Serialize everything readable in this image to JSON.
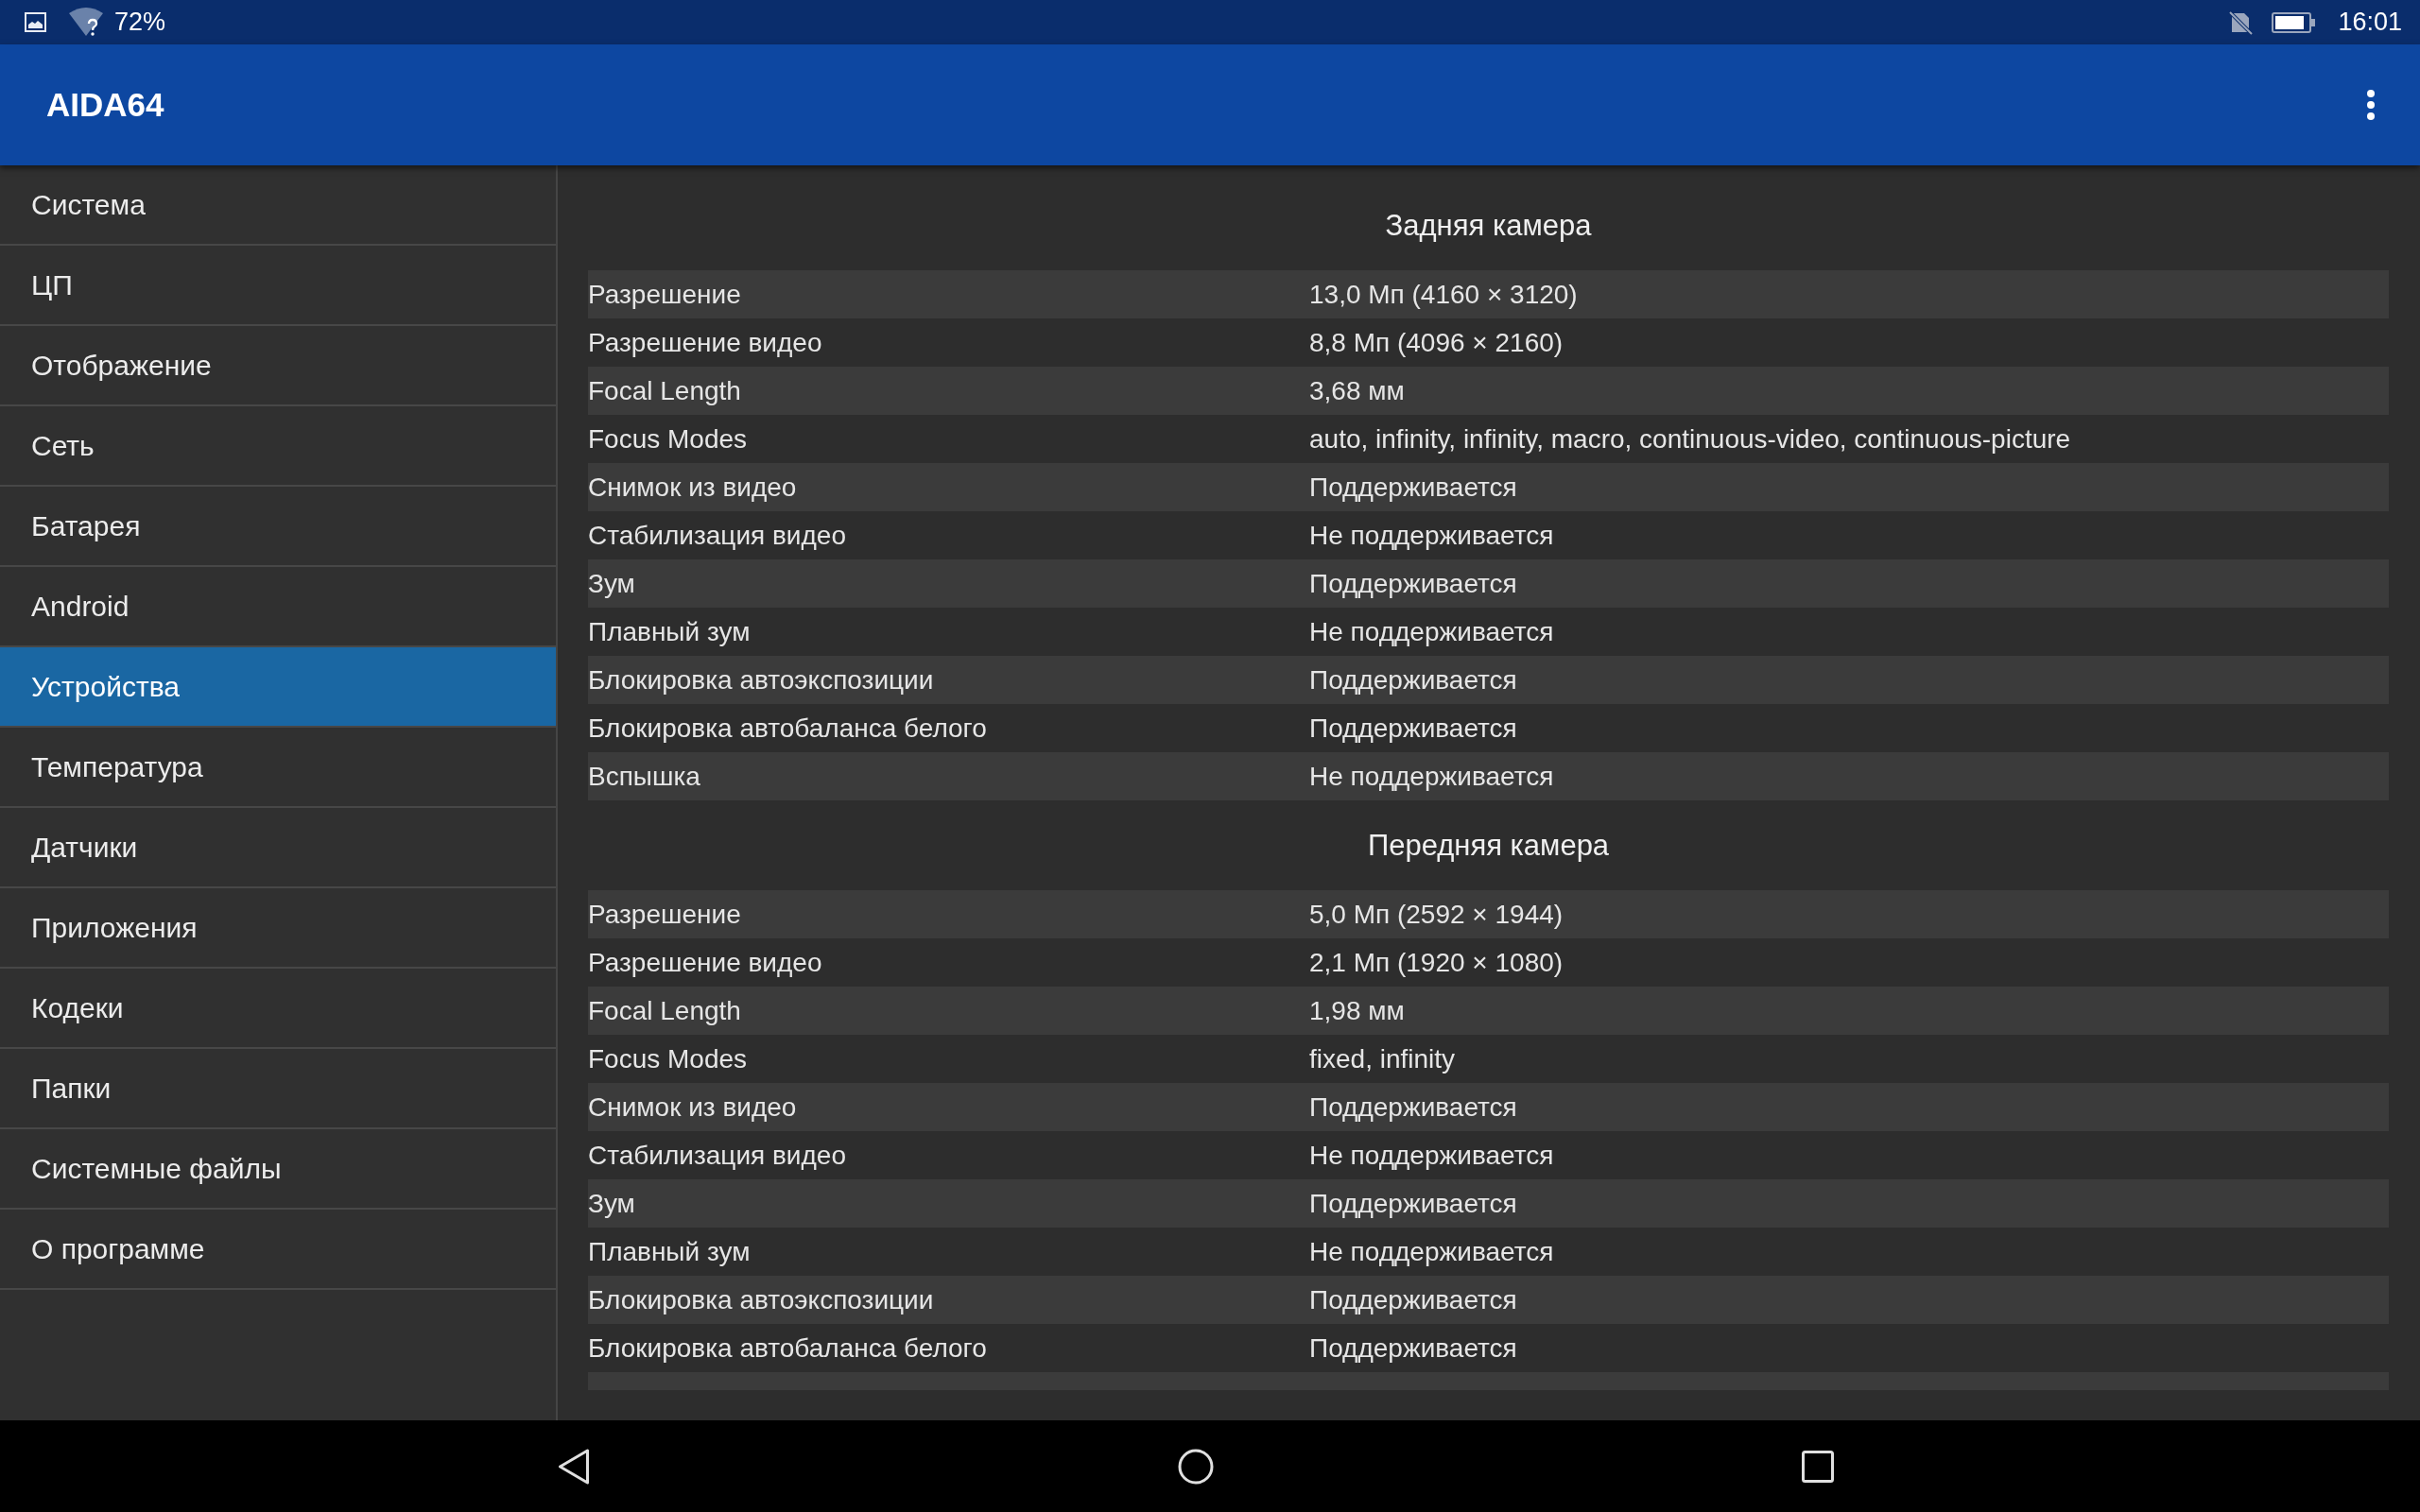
{
  "status_bar": {
    "battery_percent": "72%",
    "time": "16:01"
  },
  "app_bar": {
    "title": "AIDA64"
  },
  "sidebar": {
    "items": [
      {
        "label": "Система",
        "selected": false
      },
      {
        "label": "ЦП",
        "selected": false
      },
      {
        "label": "Отображение",
        "selected": false
      },
      {
        "label": "Сеть",
        "selected": false
      },
      {
        "label": "Батарея",
        "selected": false
      },
      {
        "label": "Android",
        "selected": false
      },
      {
        "label": "Устройства",
        "selected": true
      },
      {
        "label": "Температура",
        "selected": false
      },
      {
        "label": "Датчики",
        "selected": false
      },
      {
        "label": "Приложения",
        "selected": false
      },
      {
        "label": "Кодеки",
        "selected": false
      },
      {
        "label": "Папки",
        "selected": false
      },
      {
        "label": "Системные файлы",
        "selected": false
      },
      {
        "label": "О программе",
        "selected": false
      }
    ]
  },
  "sections": [
    {
      "title": "Задняя камера",
      "rows": [
        {
          "label": "Разрешение",
          "value": "13,0 Мп (4160 × 3120)"
        },
        {
          "label": "Разрешение видео",
          "value": "8,8 Мп (4096 × 2160)"
        },
        {
          "label": "Focal Length",
          "value": "3,68 мм"
        },
        {
          "label": "Focus Modes",
          "value": "auto, infinity, infinity, macro, continuous-video, continuous-picture"
        },
        {
          "label": "Снимок из видео",
          "value": "Поддерживается"
        },
        {
          "label": "Стабилизация видео",
          "value": "Не поддерживается"
        },
        {
          "label": "Зум",
          "value": "Поддерживается"
        },
        {
          "label": "Плавный зум",
          "value": "Не поддерживается"
        },
        {
          "label": "Блокировка автоэкспозиции",
          "value": "Поддерживается"
        },
        {
          "label": "Блокировка автобаланса белого",
          "value": "Поддерживается"
        },
        {
          "label": "Вспышка",
          "value": "Не поддерживается"
        }
      ]
    },
    {
      "title": "Передняя камера",
      "rows": [
        {
          "label": "Разрешение",
          "value": "5,0 Мп (2592 × 1944)"
        },
        {
          "label": "Разрешение видео",
          "value": "2,1 Мп (1920 × 1080)"
        },
        {
          "label": "Focal Length",
          "value": "1,98 мм"
        },
        {
          "label": "Focus Modes",
          "value": "fixed, infinity"
        },
        {
          "label": "Снимок из видео",
          "value": "Поддерживается"
        },
        {
          "label": "Стабилизация видео",
          "value": "Не поддерживается"
        },
        {
          "label": "Зум",
          "value": "Поддерживается"
        },
        {
          "label": "Плавный зум",
          "value": "Не поддерживается"
        },
        {
          "label": "Блокировка автоэкспозиции",
          "value": "Поддерживается"
        },
        {
          "label": "Блокировка автобаланса белого",
          "value": "Поддерживается"
        }
      ]
    }
  ]
}
